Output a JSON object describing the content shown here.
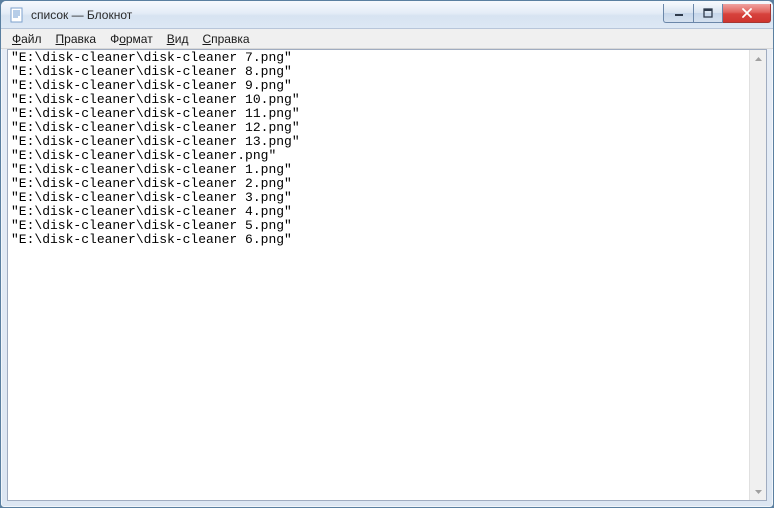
{
  "window": {
    "title": "список — Блокнот"
  },
  "menu": {
    "file": {
      "label": "Файл",
      "underline_index": 0
    },
    "edit": {
      "label": "Правка",
      "underline_index": 0
    },
    "format": {
      "label": "Формат",
      "underline_index": 1
    },
    "view": {
      "label": "Вид",
      "underline_index": 0
    },
    "help": {
      "label": "Справка",
      "underline_index": 0
    }
  },
  "content_lines": [
    "\"E:\\disk-cleaner\\disk-cleaner 7.png\"",
    "\"E:\\disk-cleaner\\disk-cleaner 8.png\"",
    "\"E:\\disk-cleaner\\disk-cleaner 9.png\"",
    "\"E:\\disk-cleaner\\disk-cleaner 10.png\"",
    "\"E:\\disk-cleaner\\disk-cleaner 11.png\"",
    "\"E:\\disk-cleaner\\disk-cleaner 12.png\"",
    "\"E:\\disk-cleaner\\disk-cleaner 13.png\"",
    "\"E:\\disk-cleaner\\disk-cleaner.png\"",
    "\"E:\\disk-cleaner\\disk-cleaner 1.png\"",
    "\"E:\\disk-cleaner\\disk-cleaner 2.png\"",
    "\"E:\\disk-cleaner\\disk-cleaner 3.png\"",
    "\"E:\\disk-cleaner\\disk-cleaner 4.png\"",
    "\"E:\\disk-cleaner\\disk-cleaner 5.png\"",
    "\"E:\\disk-cleaner\\disk-cleaner 6.png\""
  ]
}
